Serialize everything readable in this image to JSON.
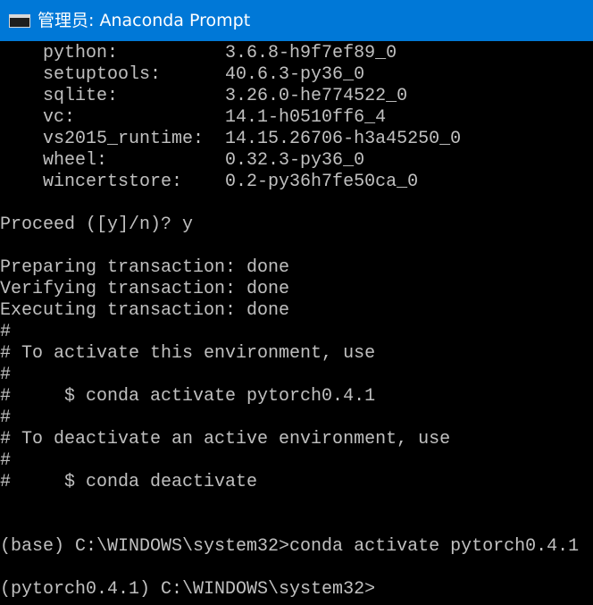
{
  "window": {
    "title": "管理员: Anaconda Prompt",
    "icon": "console-app-icon",
    "title_bar_color": "#0078d7",
    "background_color": "#000000",
    "text_color": "#c0c0c0"
  },
  "console": {
    "lines": [
      "    python:          3.6.8-h9f7ef89_0",
      "    setuptools:      40.6.3-py36_0",
      "    sqlite:          3.26.0-he774522_0",
      "    vc:              14.1-h0510ff6_4",
      "    vs2015_runtime:  14.15.26706-h3a45250_0",
      "    wheel:           0.32.3-py36_0",
      "    wincertstore:    0.2-py36h7fe50ca_0",
      "",
      "Proceed ([y]/n)? y",
      "",
      "Preparing transaction: done",
      "Verifying transaction: done",
      "Executing transaction: done",
      "#",
      "# To activate this environment, use",
      "#",
      "#     $ conda activate pytorch0.4.1",
      "#",
      "# To deactivate an active environment, use",
      "#",
      "#     $ conda deactivate",
      "",
      "",
      "(base) C:\\WINDOWS\\system32>conda activate pytorch0.4.1",
      "",
      "(pytorch0.4.1) C:\\WINDOWS\\system32>"
    ]
  }
}
